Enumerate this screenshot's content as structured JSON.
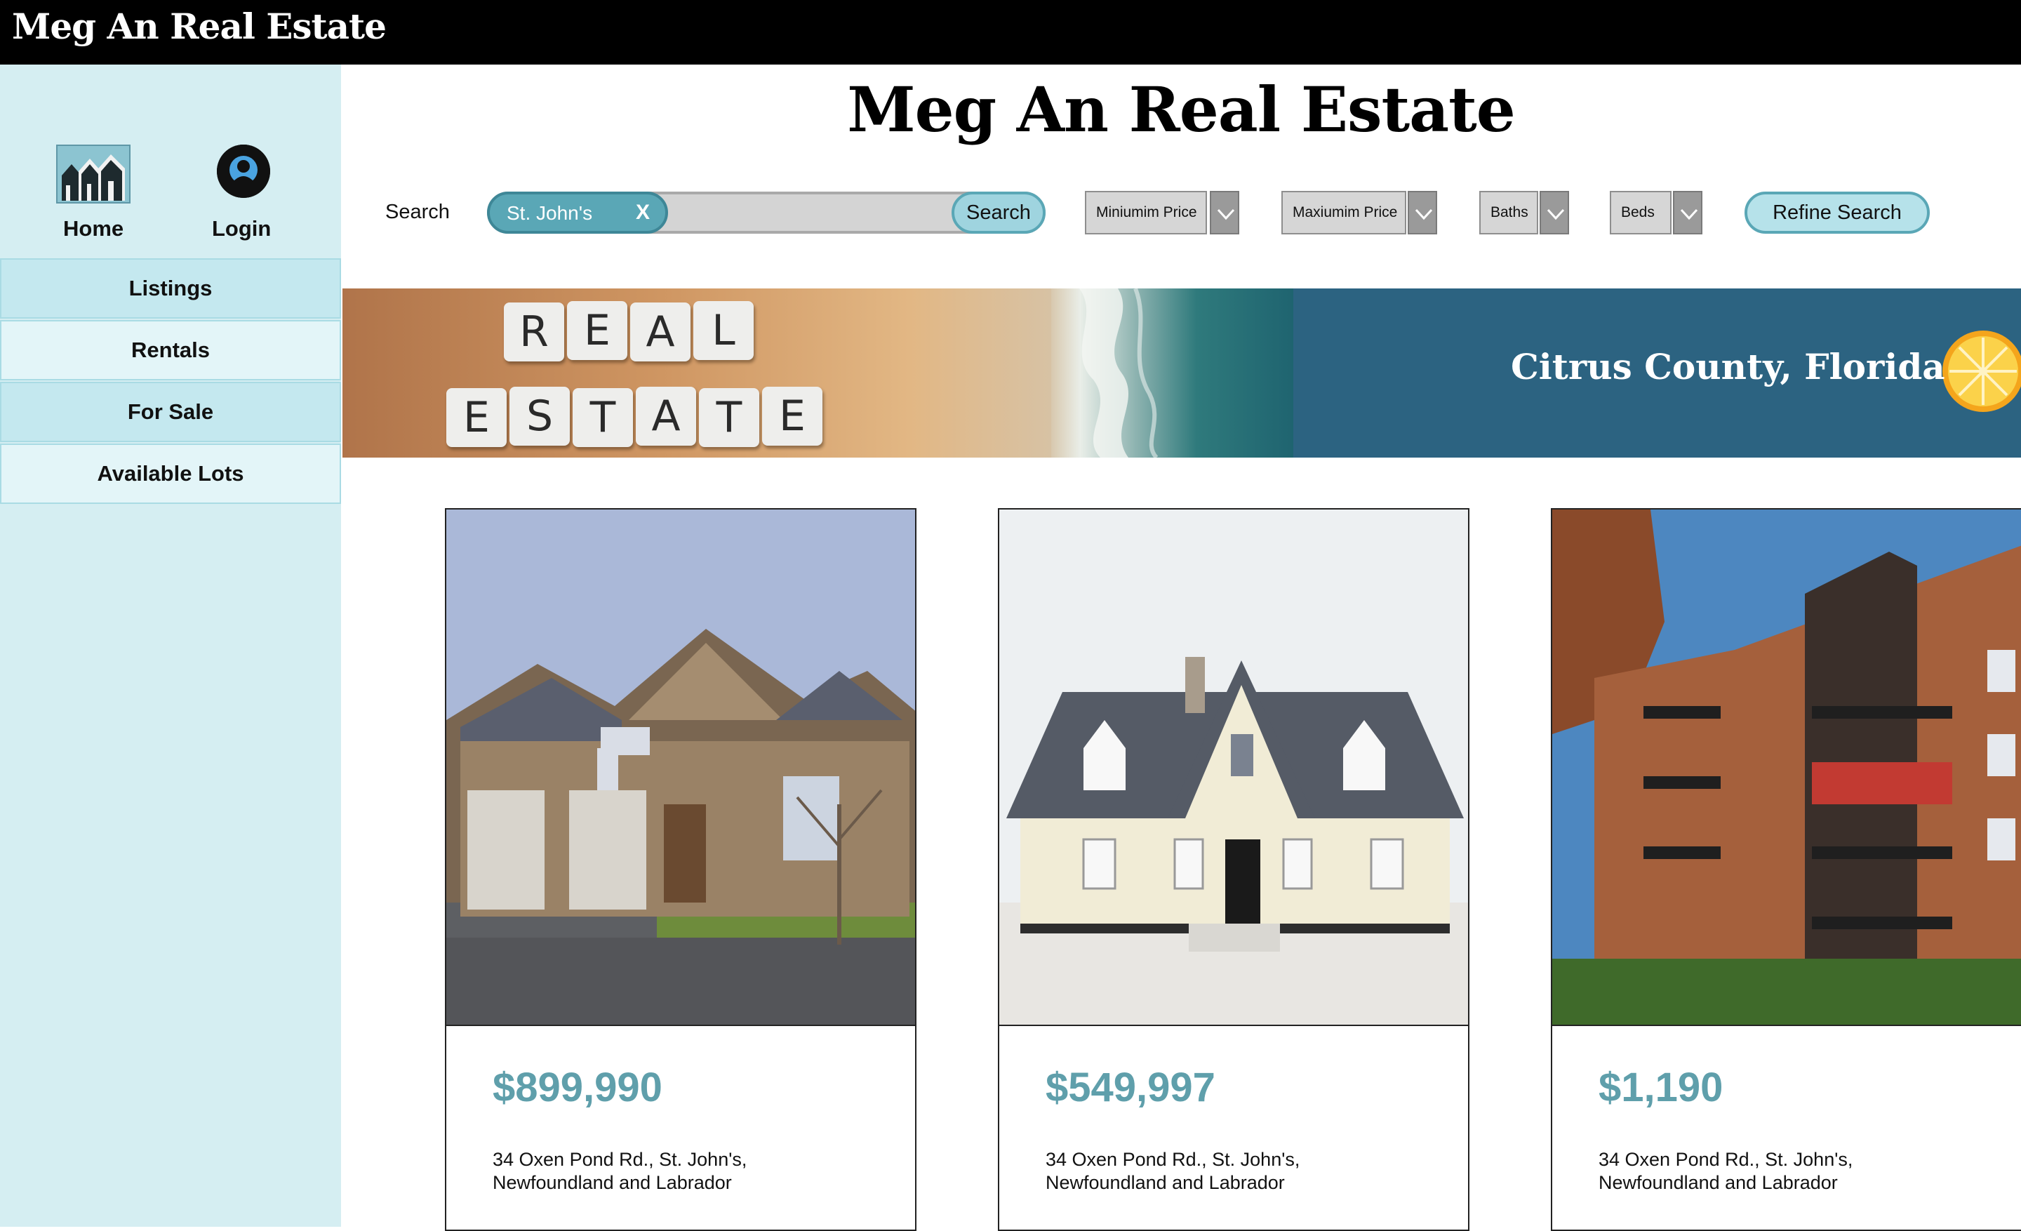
{
  "header": {
    "brand": "Meg An Real Estate"
  },
  "sidebar": {
    "home_label": "Home",
    "login_label": "Login",
    "items": [
      {
        "label": "Listings"
      },
      {
        "label": "Rentals"
      },
      {
        "label": "For Sale"
      },
      {
        "label": "Available Lots"
      }
    ]
  },
  "main": {
    "title": "Meg An Real Estate"
  },
  "search": {
    "label": "Search",
    "chip_text": "St. John's",
    "chip_clear": "X",
    "button_label": "Search",
    "filters": [
      {
        "label": "Miniumim Price"
      },
      {
        "label": "Maxiumim Price"
      },
      {
        "label": "Baths"
      },
      {
        "label": "Beds"
      }
    ],
    "refine_label": "Refine Search"
  },
  "banner": {
    "tiles_row1": [
      "R",
      "E",
      "A",
      "L"
    ],
    "tiles_row2": [
      "E",
      "S",
      "T",
      "A",
      "T",
      "E"
    ],
    "caption": "Citrus County, Florida"
  },
  "listings": [
    {
      "price": "$899,990",
      "address_line1": "34 Oxen Pond Rd., St. John's,",
      "address_line2": "Newfoundland and Labrador"
    },
    {
      "price": "$549,997",
      "address_line1": "34 Oxen Pond Rd., St. John's,",
      "address_line2": "Newfoundland and Labrador"
    },
    {
      "price": "$1,190",
      "address_line1": "34 Oxen Pond Rd., St. John's,",
      "address_line2": "Newfoundland and Labrador"
    }
  ],
  "colors": {
    "accent": "#5aa7b6",
    "sidebar": "#d5eef2",
    "price": "#5f9fab",
    "banner_blue": "#2c6381"
  },
  "icons": [
    "home-icon",
    "login-avatar-icon",
    "chevron-down-icon",
    "orange-slice-icon"
  ]
}
